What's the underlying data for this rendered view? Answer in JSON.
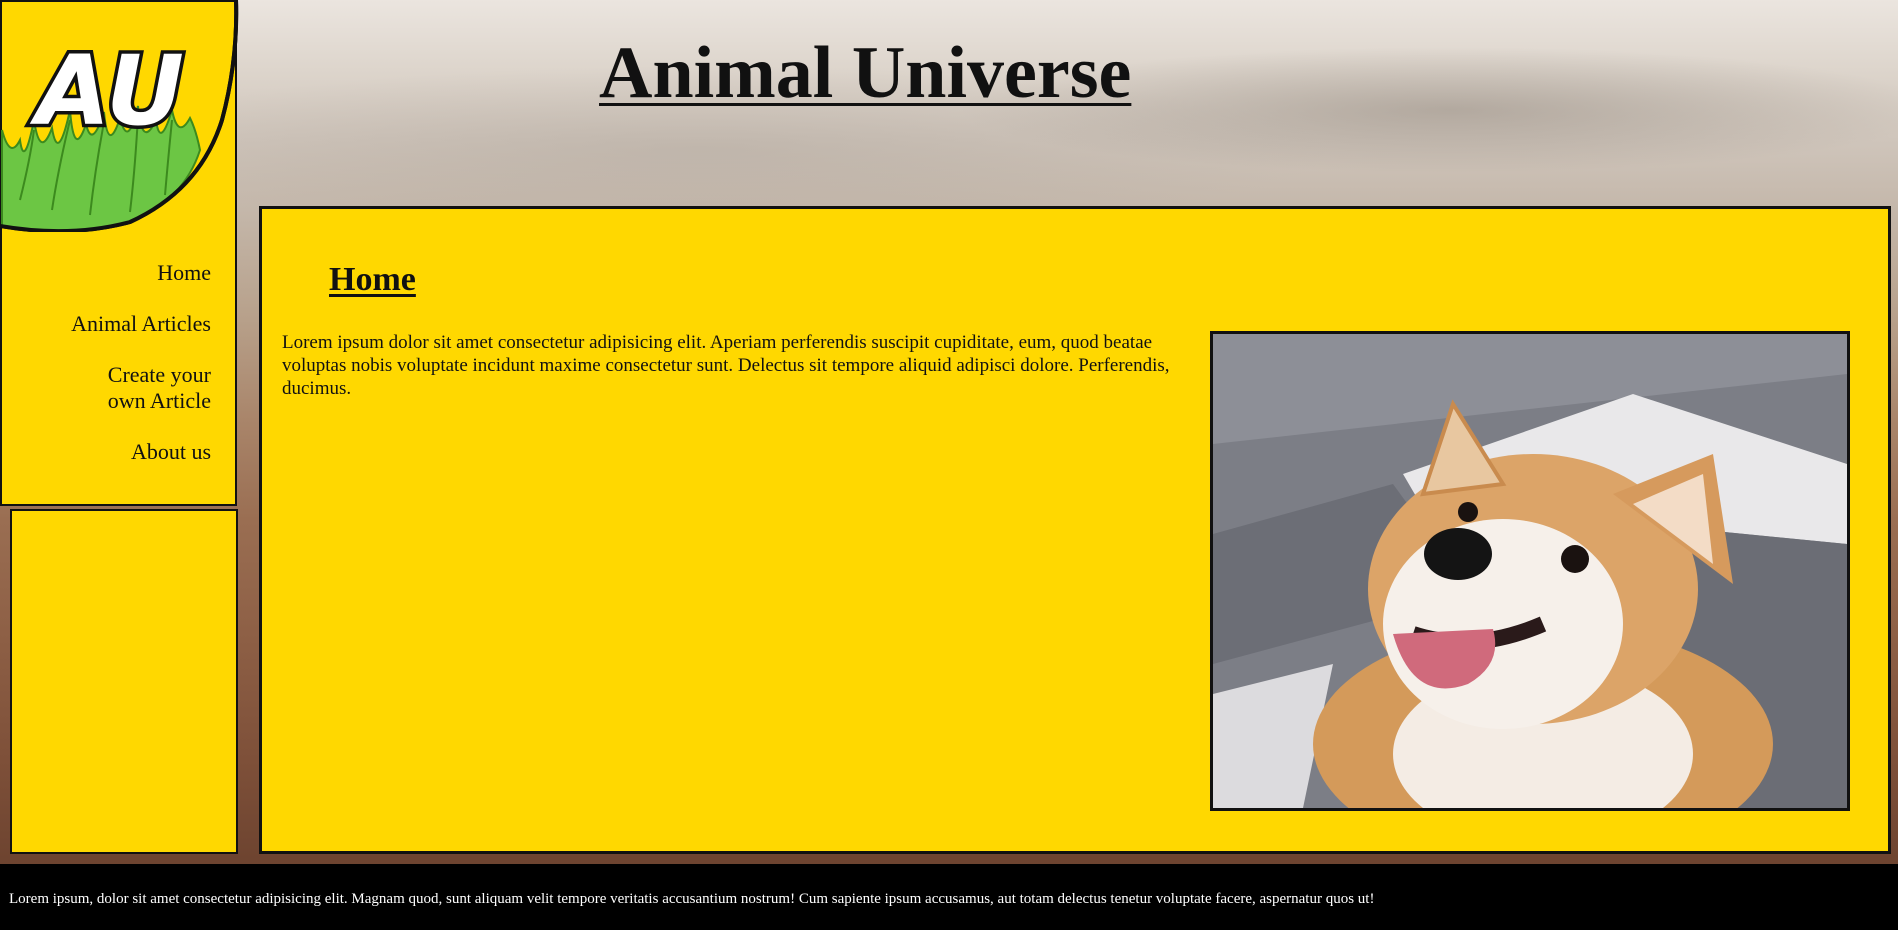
{
  "logo": {
    "text": "AU"
  },
  "header": {
    "title": "Animal Universe"
  },
  "nav": {
    "items": [
      {
        "label": "Home"
      },
      {
        "label": "Animal Articles"
      },
      {
        "label": "Create your own Article"
      },
      {
        "label": "About us"
      }
    ]
  },
  "main": {
    "heading": "Home",
    "intro": "Lorem ipsum dolor sit amet consectetur adipisicing elit. Aperiam perferendis suscipit cupiditate, eum, quod beatae voluptas nobis voluptate incidunt maxime consectetur sunt. Delectus sit tempore aliquid adipisci dolore. Perferendis, ducimus."
  },
  "footer": {
    "text": "Lorem ipsum, dolor sit amet consectetur adipisicing elit. Magnam quod, sunt aliquam velit tempore veritatis accusantium nostrum! Cum sapiente ipsum accusamus, aut totam delectus tenetur voluptate facere, aspernatur quos ut!"
  },
  "colors": {
    "panel": "#ffd800",
    "border": "#111111",
    "footer_bg": "#000000",
    "logo_grass": "#6cc644"
  }
}
